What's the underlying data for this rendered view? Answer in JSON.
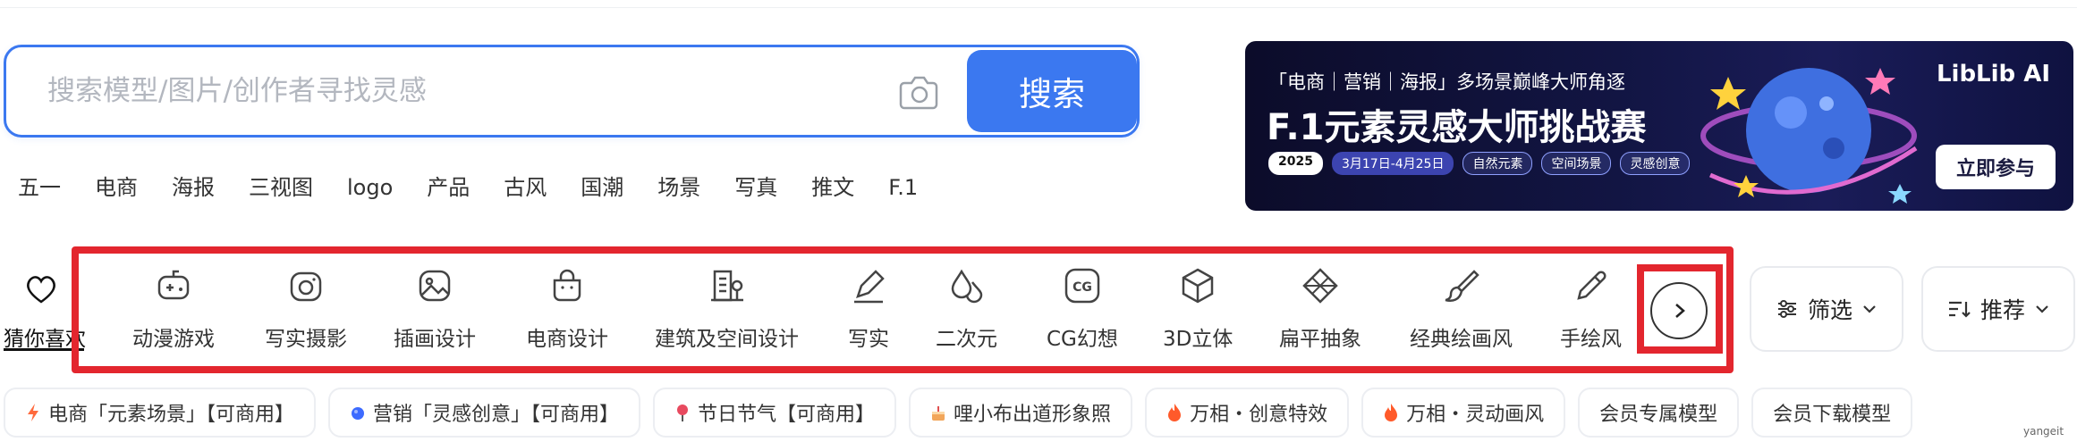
{
  "search": {
    "placeholder": "搜索模型/图片/创作者寻找灵感",
    "button_label": "搜索",
    "camera_icon": "camera-icon"
  },
  "hot_tags": [
    "五一",
    "电商",
    "海报",
    "三视图",
    "logo",
    "产品",
    "古风",
    "国潮",
    "场景",
    "写真",
    "推文",
    "F.1"
  ],
  "banner": {
    "subtitle": "「电商｜营销｜海报」多场景巅峰大师角逐",
    "headline": "F.1元素灵感大师挑战赛",
    "year": "2025",
    "date_range": "3月17日-4月25日",
    "chips": [
      "自然元素",
      "空间场景",
      "灵感创意"
    ],
    "brand": "LibLib AI",
    "cta": "立即参与"
  },
  "categories": {
    "guess_label": "猜你喜欢",
    "items": [
      {
        "label": "动漫游戏",
        "icon": "gamepad-icon"
      },
      {
        "label": "写实摄影",
        "icon": "camera-icon"
      },
      {
        "label": "插画设计",
        "icon": "image-icon"
      },
      {
        "label": "电商设计",
        "icon": "shopping-bag-icon"
      },
      {
        "label": "建筑及空间设计",
        "icon": "building-icon"
      },
      {
        "label": "写实",
        "icon": "pen-icon"
      },
      {
        "label": "二次元",
        "icon": "drops-icon"
      },
      {
        "label": "CG幻想",
        "icon": "cg-icon"
      },
      {
        "label": "3D立体",
        "icon": "cube-icon"
      },
      {
        "label": "扁平抽象",
        "icon": "gem-icon"
      },
      {
        "label": "经典绘画风",
        "icon": "brush-icon"
      },
      {
        "label": "手绘风",
        "icon": "pencil-icon"
      }
    ]
  },
  "filter": {
    "label": "筛选"
  },
  "sort": {
    "label": "推荐"
  },
  "bottom_tags": [
    {
      "label": "电商「元素场景」【可商用】",
      "icon": "lightning-icon",
      "color": "#ff6a3d"
    },
    {
      "label": "营销「灵感创意」【可商用】",
      "icon": "globe-icon",
      "color": "#3d6bff"
    },
    {
      "label": "节日节气【可商用】",
      "icon": "pin-icon",
      "color": "#e84a5f"
    },
    {
      "label": "哩小布出道形象照",
      "icon": "cake-icon",
      "color": "#f2a65a"
    },
    {
      "label": "万相・创意特效",
      "icon": "fire-icon",
      "color": "#ff5a2a"
    },
    {
      "label": "万相・灵动画风",
      "icon": "fire-icon",
      "color": "#ff5a2a"
    },
    {
      "label": "会员专属模型",
      "icon": "",
      "color": ""
    },
    {
      "label": "会员下载模型",
      "icon": "",
      "color": ""
    }
  ],
  "watermark": "yangeit"
}
